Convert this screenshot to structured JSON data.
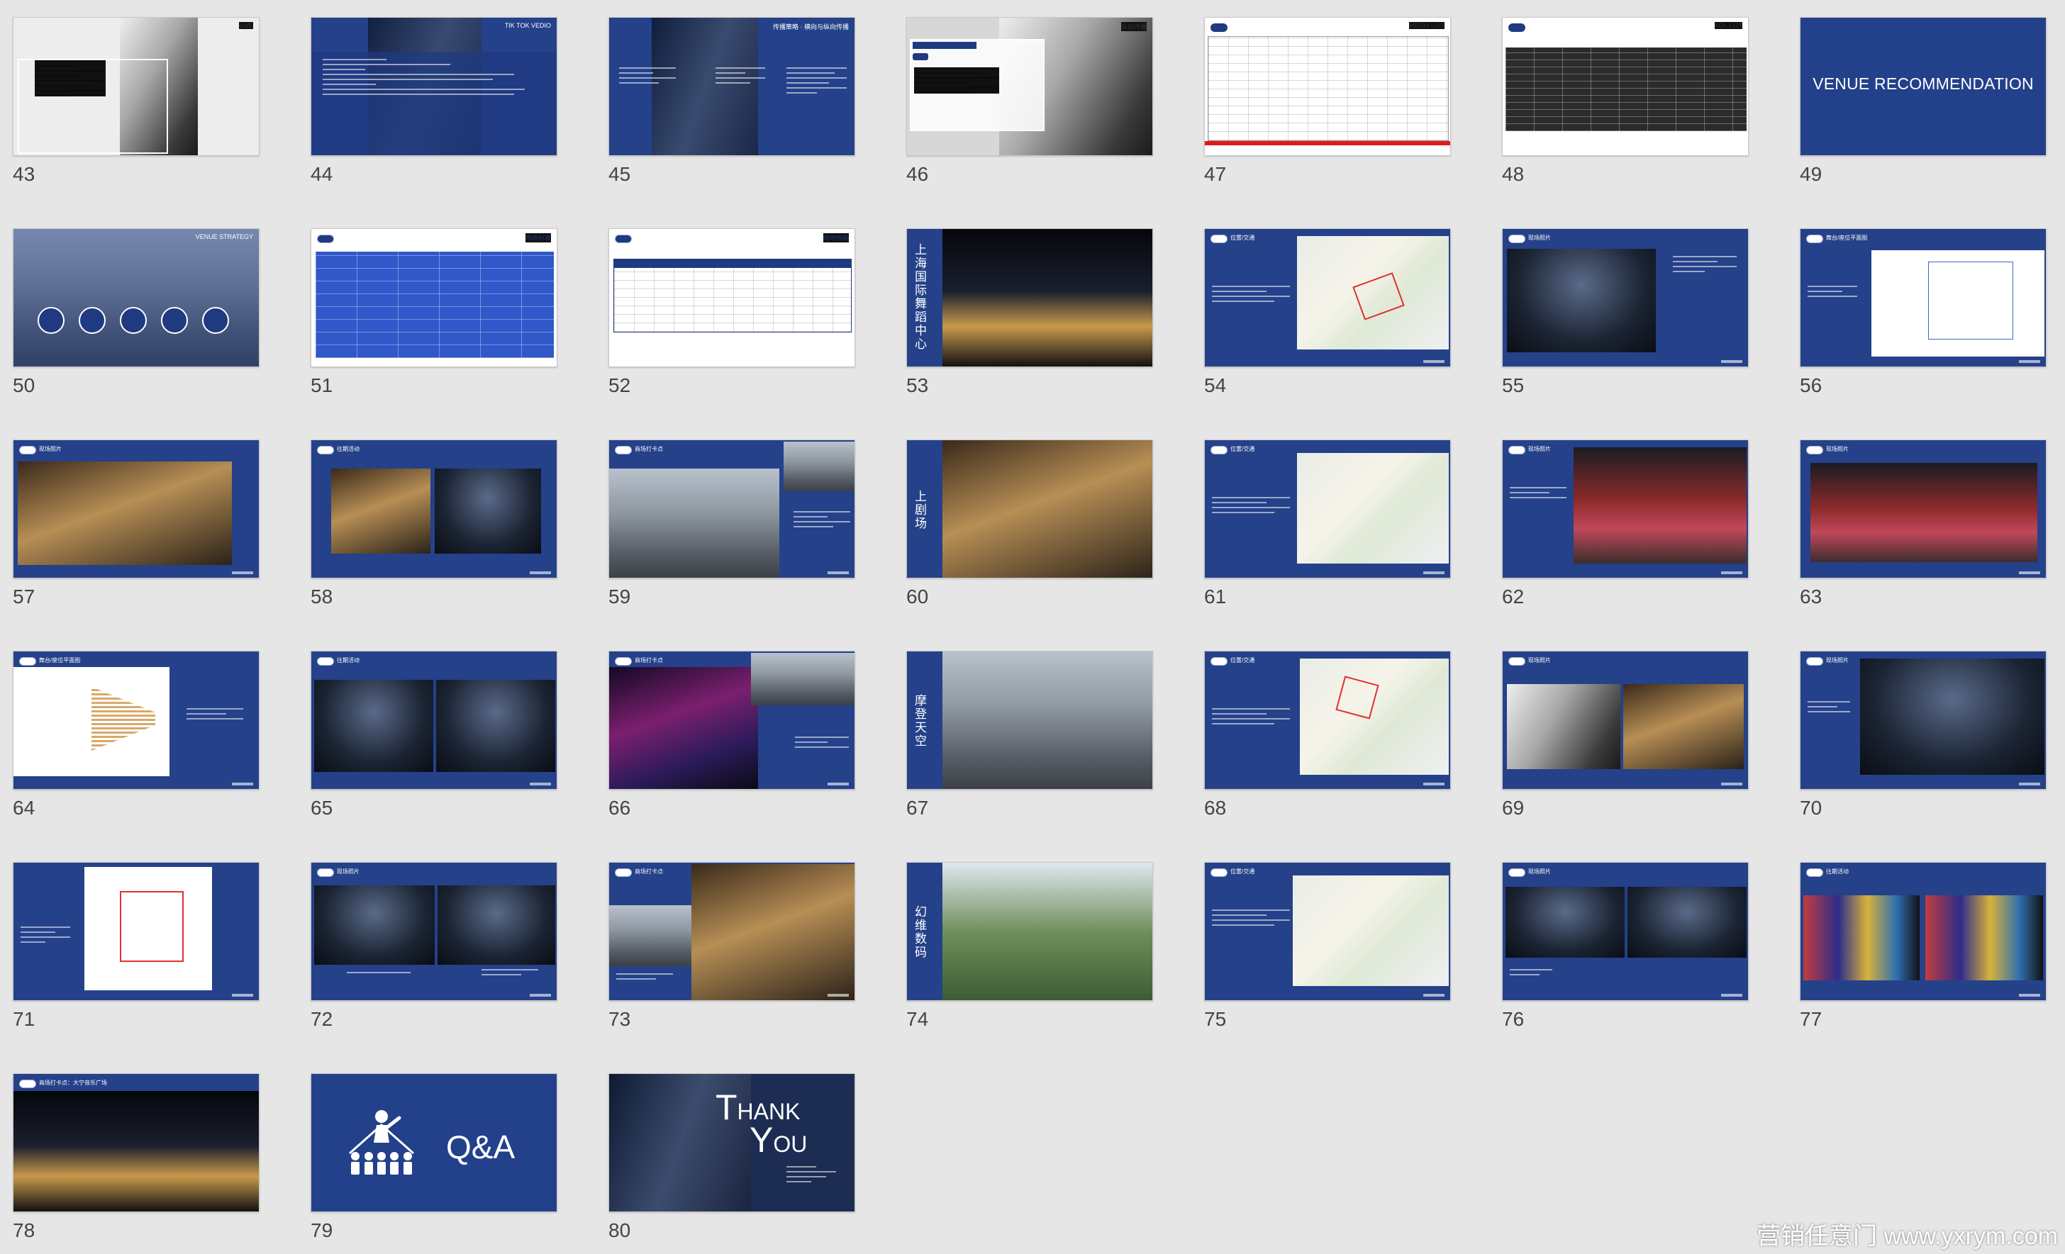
{
  "slides": [
    {
      "num": "43",
      "corner": "LIVE"
    },
    {
      "num": "44",
      "corner": "TIK TOK VEDIO"
    },
    {
      "num": "45",
      "corner": "传播策略 · 横向与纵向传播"
    },
    {
      "num": "46",
      "corner": "纵向传播"
    },
    {
      "num": "47",
      "corner": "MEDIA LIST"
    },
    {
      "num": "48",
      "corner": "KOL LIST"
    },
    {
      "num": "49",
      "title": "VENUE RECOMMENDATION"
    },
    {
      "num": "50",
      "corner": "VENUE STRATEGY"
    },
    {
      "num": "51",
      "corner": "场地列表"
    },
    {
      "num": "52",
      "corner": "场地档期"
    },
    {
      "num": "53",
      "vtitle": "上海国际舞蹈中心"
    },
    {
      "num": "54",
      "header": "位置/交通"
    },
    {
      "num": "55",
      "header": "现场照片"
    },
    {
      "num": "56",
      "header": "舞台/座位平面图"
    },
    {
      "num": "57",
      "header": "现场照片"
    },
    {
      "num": "58",
      "header": "往期活动"
    },
    {
      "num": "59",
      "header": "商场打卡点"
    },
    {
      "num": "60",
      "vtitle": "上剧场"
    },
    {
      "num": "61",
      "header": "位置/交通"
    },
    {
      "num": "62",
      "header": "现场照片"
    },
    {
      "num": "63",
      "header": "现场照片"
    },
    {
      "num": "64",
      "header": "舞台/座位平面图"
    },
    {
      "num": "65",
      "header": "往期活动"
    },
    {
      "num": "66",
      "header": "商场打卡点"
    },
    {
      "num": "67",
      "vtitle": "摩登天空"
    },
    {
      "num": "68",
      "header": "位置/交通"
    },
    {
      "num": "69",
      "header": "现场照片"
    },
    {
      "num": "70",
      "header": "现场照片"
    },
    {
      "num": "71"
    },
    {
      "num": "72",
      "header": "现场照片"
    },
    {
      "num": "73",
      "header": "商场打卡点"
    },
    {
      "num": "74",
      "vtitle": "幻维数码"
    },
    {
      "num": "75",
      "header": "位置/交通"
    },
    {
      "num": "76",
      "header": "现场照片"
    },
    {
      "num": "77",
      "header": "往期活动"
    },
    {
      "num": "78",
      "header": "商场打卡点：大宁音乐广场"
    },
    {
      "num": "79",
      "title": "Q&A"
    },
    {
      "num": "80",
      "thanks_t": "T",
      "thanks_hank": "HANK",
      "thanks_y": "Y",
      "thanks_ou": "OU"
    }
  ],
  "watermark": "营销任意门 www.yxrym.com"
}
